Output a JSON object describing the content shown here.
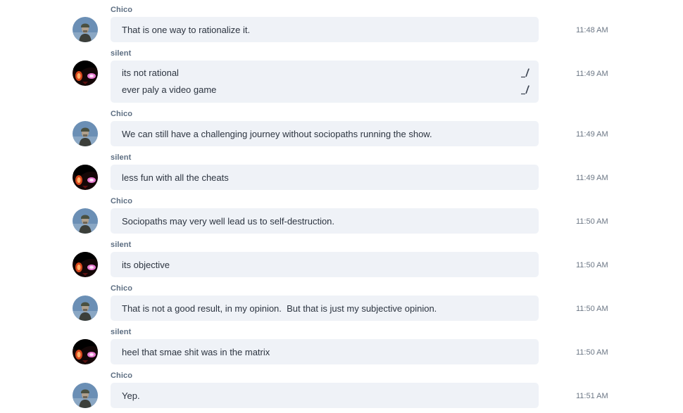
{
  "colors": {
    "bubble_bg": "#eff2f7",
    "author_name": "#5d6e82",
    "message_text": "#2c3440",
    "timestamp": "#6c7785"
  },
  "users": {
    "chico": {
      "name": "Chico",
      "avatar": "soldier-avatar"
    },
    "silent": {
      "name": "silent",
      "avatar": "red-eyed-character-avatar"
    }
  },
  "messages": [
    {
      "author": "Chico",
      "time": "11:48 AM",
      "lines": [
        {
          "text": "That is one way to rationalize it.",
          "edited": false
        }
      ]
    },
    {
      "author": "silent",
      "time": "11:49 AM",
      "lines": [
        {
          "text": "its not rational",
          "edited": true,
          "edit_icon": "pencil-icon"
        },
        {
          "text": "ever paly a video game",
          "edited": true,
          "edit_icon": "pencil-icon"
        }
      ]
    },
    {
      "author": "Chico",
      "time": "11:49 AM",
      "lines": [
        {
          "text": "We can still have a challenging journey without sociopaths running the show.",
          "edited": false
        }
      ]
    },
    {
      "author": "silent",
      "time": "11:49 AM",
      "lines": [
        {
          "text": "less fun with all the cheats",
          "edited": false
        }
      ]
    },
    {
      "author": "Chico",
      "time": "11:50 AM",
      "lines": [
        {
          "text": "Sociopaths may very well lead us to self-destruction.",
          "edited": false
        }
      ]
    },
    {
      "author": "silent",
      "time": "11:50 AM",
      "lines": [
        {
          "text": "its objective",
          "edited": false
        }
      ]
    },
    {
      "author": "Chico",
      "time": "11:50 AM",
      "lines": [
        {
          "text": "That is not a good result, in my opinion.  But that is just my subjective opinion.",
          "edited": false
        }
      ]
    },
    {
      "author": "silent",
      "time": "11:50 AM",
      "lines": [
        {
          "text": "heel that smae shit was in the matrix",
          "edited": false
        }
      ]
    },
    {
      "author": "Chico",
      "time": "11:51 AM",
      "lines": [
        {
          "text": "Yep.",
          "edited": false
        }
      ]
    }
  ]
}
